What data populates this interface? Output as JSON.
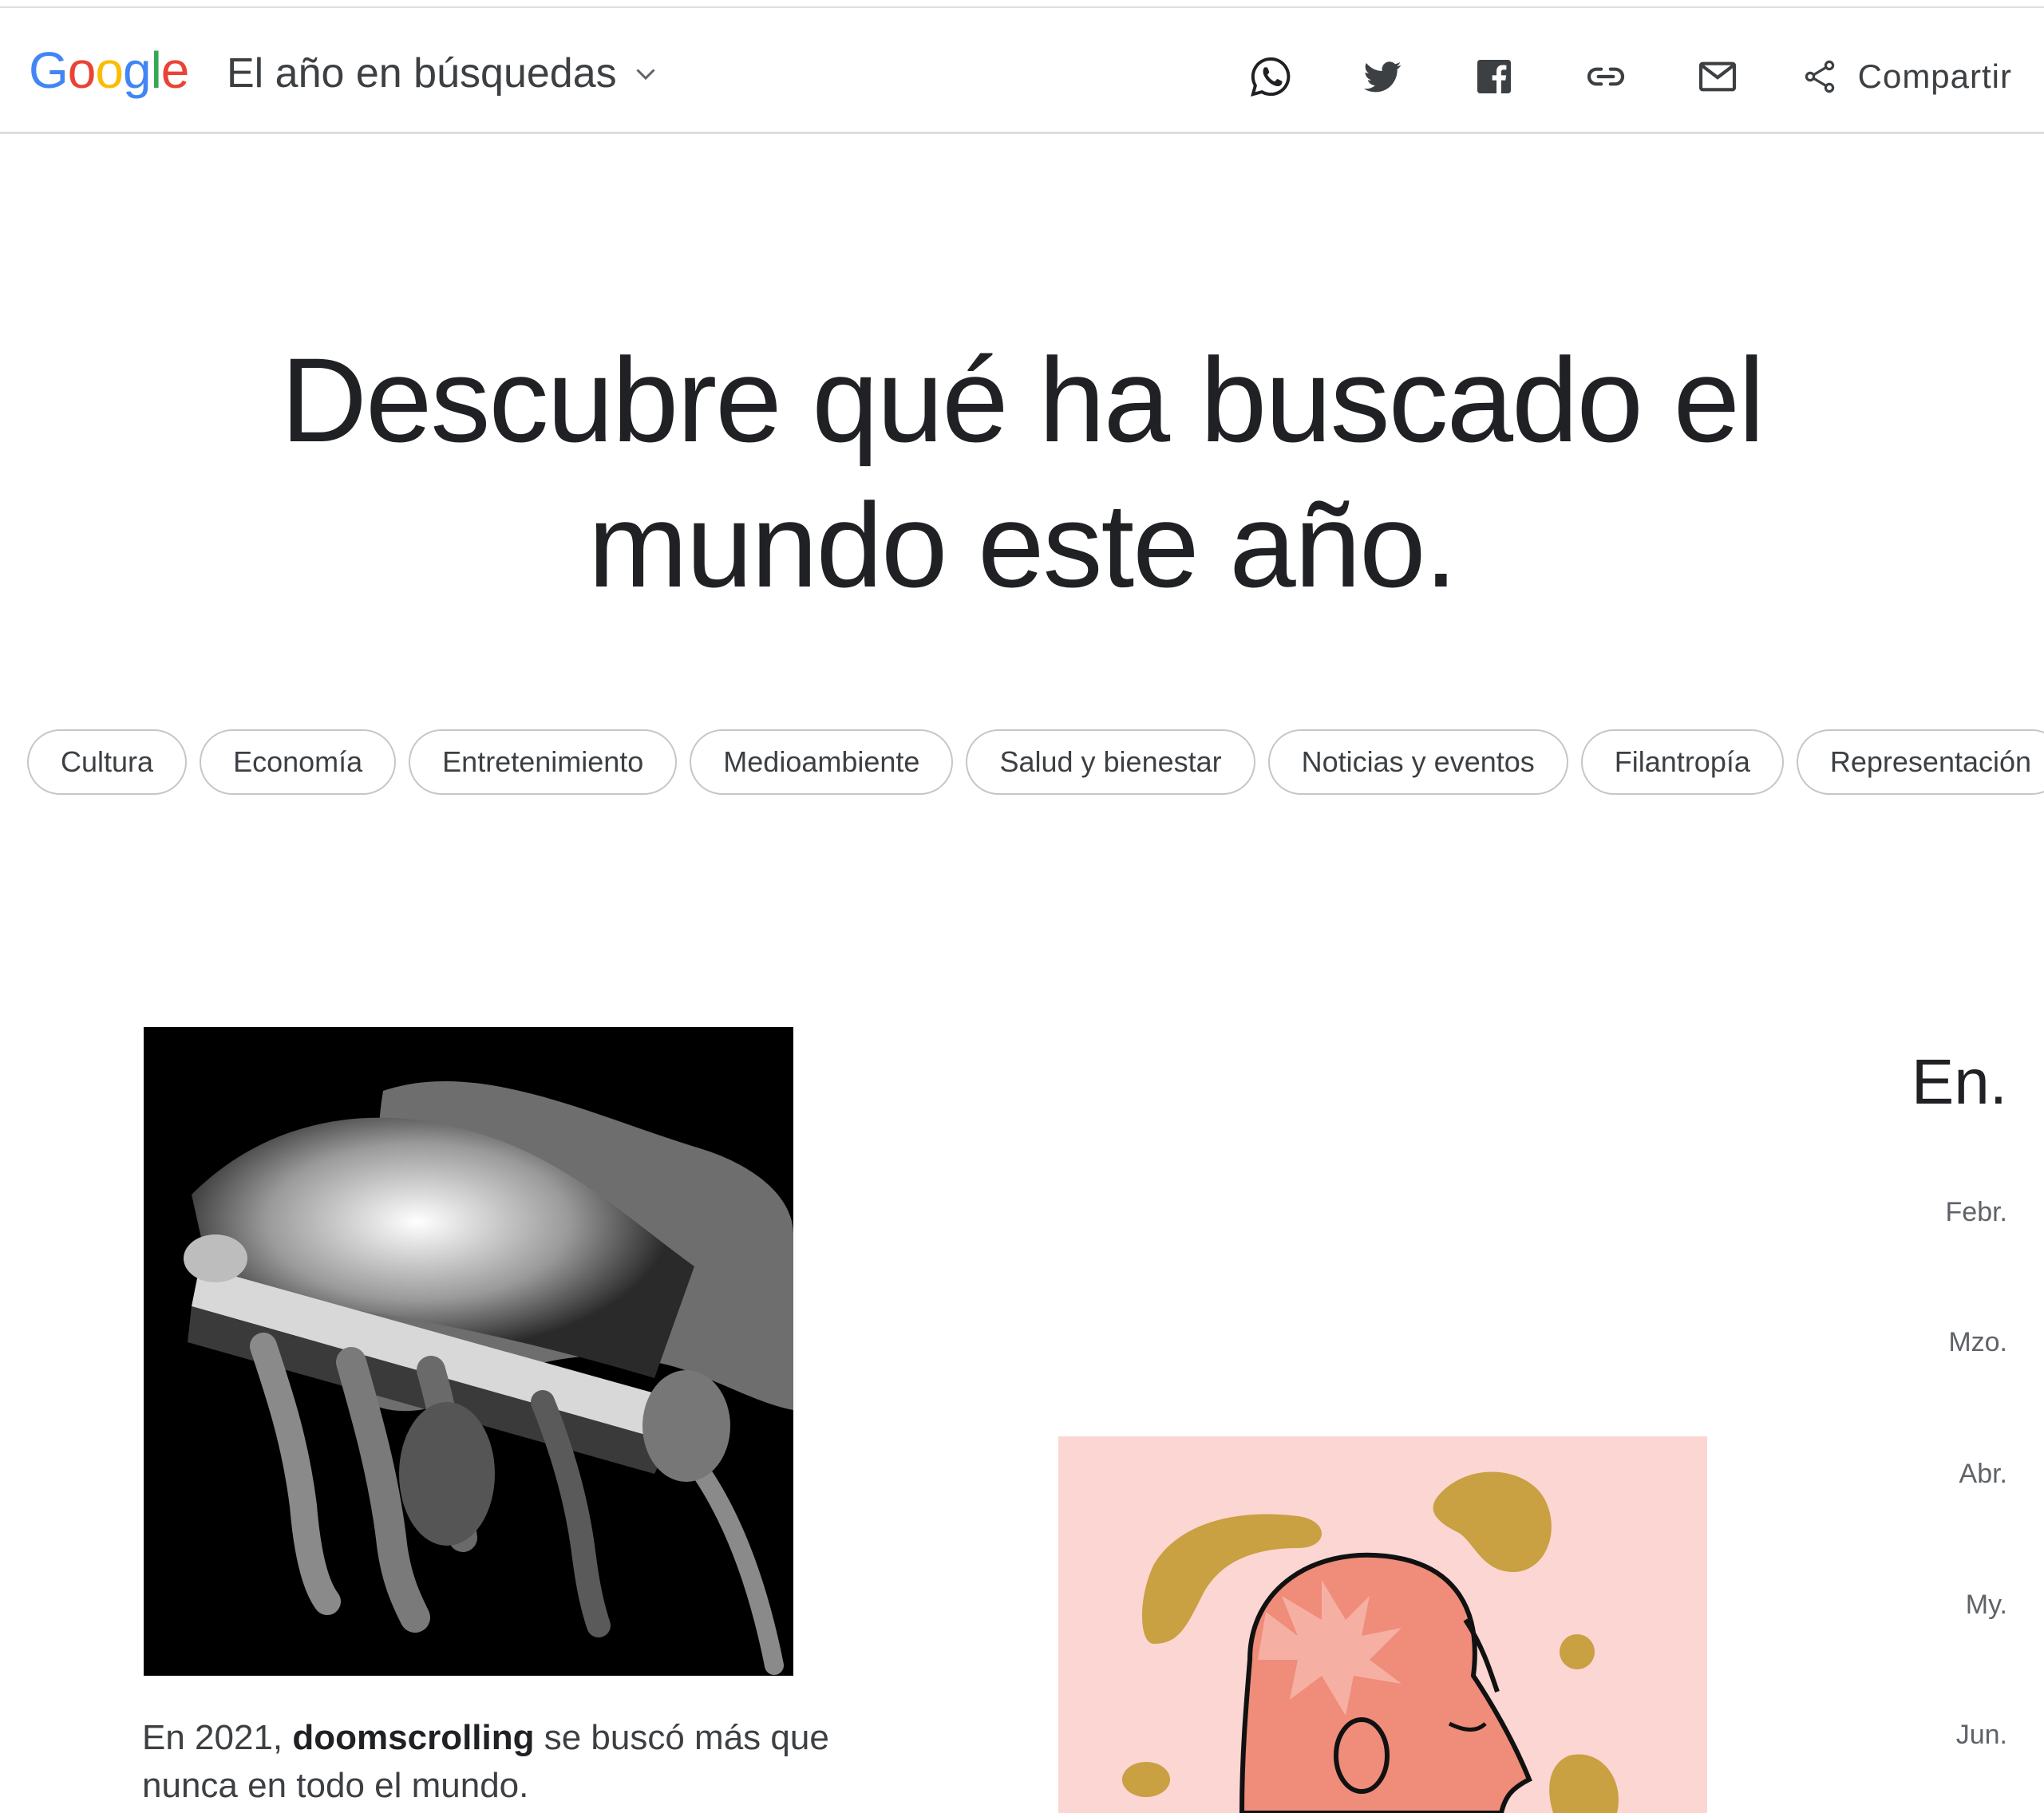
{
  "header": {
    "logo_letters": [
      {
        "ch": "G",
        "color": "#4285F4"
      },
      {
        "ch": "o",
        "color": "#EA4335"
      },
      {
        "ch": "o",
        "color": "#FBBC05"
      },
      {
        "ch": "g",
        "color": "#4285F4"
      },
      {
        "ch": "l",
        "color": "#34A853"
      },
      {
        "ch": "e",
        "color": "#EA4335"
      }
    ],
    "section_title": "El año en búsquedas",
    "share_icons": [
      "whatsapp-icon",
      "twitter-icon",
      "facebook-icon",
      "link-icon",
      "email-icon"
    ],
    "share_label": "Compartir"
  },
  "hero": {
    "line1": "Descubre qué ha buscado el",
    "line2": "mundo este año."
  },
  "categories": [
    "Cultura",
    "Economía",
    "Entretenimiento",
    "Medioambiente",
    "Salud y bienestar",
    "Noticias y eventos",
    "Filantropía",
    "Representación"
  ],
  "story": {
    "caption_prefix": "En 2021, ",
    "caption_term": "doomscrolling",
    "caption_suffix": " se buscó más que nunca en todo el mundo."
  },
  "timeline": {
    "current": "En.",
    "months": [
      "Febr.",
      "Mzo.",
      "Abr.",
      "My.",
      "Jun."
    ]
  },
  "colors": {
    "accent_pink": "#fbd6d2",
    "illustration_gold": "#c9a042",
    "illustration_coral": "#f08c7a"
  }
}
